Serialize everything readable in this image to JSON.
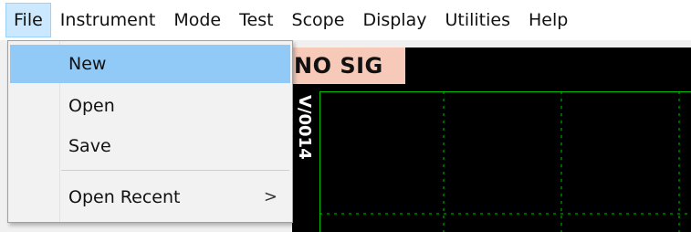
{
  "menubar": {
    "items": [
      {
        "label": "File"
      },
      {
        "label": "Instrument"
      },
      {
        "label": "Mode"
      },
      {
        "label": "Test"
      },
      {
        "label": "Scope"
      },
      {
        "label": "Display"
      },
      {
        "label": "Utilities"
      },
      {
        "label": "Help"
      }
    ]
  },
  "file_menu": {
    "items": [
      {
        "label": "New",
        "highlighted": true
      },
      {
        "label": "Open"
      },
      {
        "label": "Save"
      },
      {
        "label": "Open Recent",
        "submenu_arrow": ">"
      }
    ]
  },
  "scope": {
    "status": "NO SIG",
    "channel_label": "V/0014",
    "grid_color": "#00c000",
    "background": "#000000"
  },
  "colors": {
    "menu_active_bg": "#cce8ff",
    "item_highlight_bg": "#91c9f7",
    "status_bg": "#f6c9b8"
  }
}
